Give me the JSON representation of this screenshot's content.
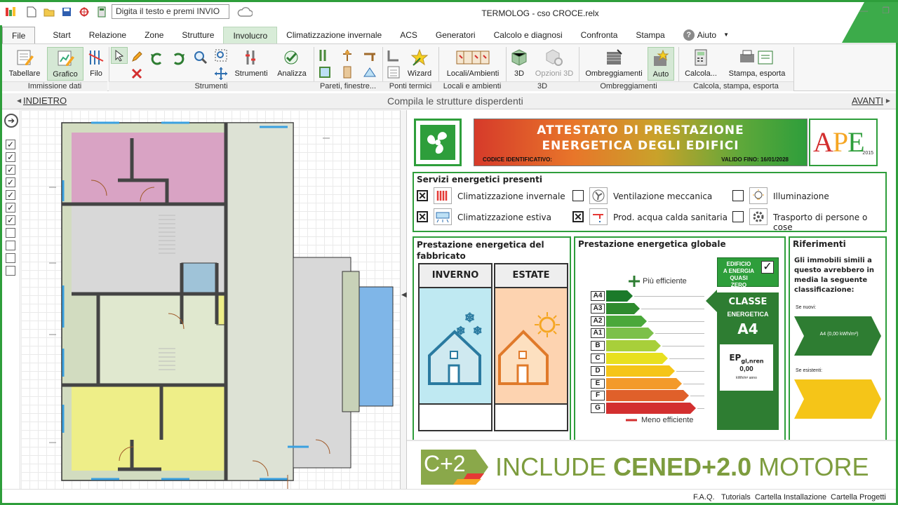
{
  "titlebar": {
    "search_placeholder": "Digita il testo e premi INVIO",
    "window_title": "TERMOLOG - cso CROCE.relx"
  },
  "menu": {
    "tabs": [
      "File",
      "Start",
      "Relazione",
      "Zone",
      "Strutture",
      "Involucro",
      "Climatizzazione invernale",
      "ACS",
      "Generatori",
      "Calcolo e diagnosi",
      "Confronta",
      "Stampa",
      "Aiuto"
    ],
    "active": "Involucro"
  },
  "ribbon": {
    "buttons": {
      "tabellare": "Tabellare",
      "grafico": "Grafico",
      "filo": "Filo",
      "strumenti": "Strumenti",
      "analizza": "Analizza",
      "wizard": "Wizard",
      "locali": "Locali/Ambienti",
      "b3d": "3D",
      "opzioni3d": "Opzioni 3D",
      "ombreggiamenti": "Ombreggiamenti",
      "auto": "Auto",
      "calcola": "Calcola...",
      "stampa": "Stampa, esporta"
    },
    "groups": {
      "immissione": "Immissione dati",
      "strumenti": "Strumenti",
      "pareti": "Pareti, finestre...",
      "ponti": "Ponti termici",
      "locali": "Locali e ambienti",
      "g3d": "3D",
      "ombre": "Ombreggiamenti",
      "calcola": "Calcola, stampa, esporta"
    }
  },
  "nav": {
    "back": "INDIETRO",
    "title": "Compila le strutture disperdenti",
    "forward": "AVANTI"
  },
  "left_checks": [
    true,
    true,
    true,
    true,
    true,
    true,
    true,
    false,
    false,
    false,
    false
  ],
  "ape": {
    "header_line1": "ATTESTATO DI PRESTAZIONE",
    "header_line2": "ENERGETICA DEGLI EDIFICI",
    "codice": "CODICE IDENTIFICATIVO:",
    "valido": "VALIDO FINO: 16/01/2028",
    "logo_text": "APE",
    "logo_year": "2015",
    "servizi_title": "Servizi energetici presenti",
    "services": [
      {
        "label": "Climatizzazione invernale",
        "checked": true
      },
      {
        "label": "Climatizzazione estiva",
        "checked": true
      },
      {
        "label": "Ventilazione meccanica",
        "checked": false
      },
      {
        "label": "Prod. acqua calda sanitaria",
        "checked": true
      },
      {
        "label": "Illuminazione",
        "checked": false
      },
      {
        "label": "Trasporto di persone o cose",
        "checked": false
      }
    ],
    "fabbricato_title_1": "Prestazione energetica del",
    "fabbricato_title_2": "fabbricato",
    "inverno": "INVERNO",
    "estate": "ESTATE",
    "globale_title": "Prestazione energetica globale",
    "piu_efficiente": "Più efficiente",
    "meno_efficiente": "Meno efficiente",
    "classes": [
      "A4",
      "A3",
      "A2",
      "A1",
      "B",
      "C",
      "D",
      "E",
      "F",
      "G"
    ],
    "nzeb_1": "EDIFICIO",
    "nzeb_2": "A ENERGIA",
    "nzeb_3": "QUASI ZERO",
    "classe_label": "CLASSE",
    "energetica_label": "ENERGETICA",
    "classe_value": "A4",
    "ep_label": "EP",
    "ep_sub": "gl,nren",
    "ep_value": "0,00",
    "ep_unit": "kWh/m² anno",
    "riferimenti_title": "Riferimenti",
    "riferimenti_text_1": "Gli immobili simili a",
    "riferimenti_text_2": "questo avrebbero in",
    "riferimenti_text_3": "media la seguente",
    "riferimenti_text_4": "classificazione:",
    "se_nuovi": "Se nuovi:",
    "nuovi_value": "A4 (0,00 kWh/m²)",
    "se_esistenti": "Se esistenti:"
  },
  "banner": {
    "logo": "C+2",
    "text_light": "INCLUDE ",
    "text_bold": "CENED+2.0",
    "text_end": " MOTORE"
  },
  "footer": {
    "faq": "F.A.Q.",
    "tutorials": "Tutorials",
    "installazione": "Cartella Installazione",
    "progetti": "Cartella Progetti"
  },
  "colors": {
    "accent_green": "#2e9e3b",
    "room_pink": "#d9a3c4",
    "room_yellow": "#eeee88",
    "room_blue": "#7fb6e8",
    "room_gray": "#d8d8d8",
    "room_sage": "#e0e8cf"
  }
}
